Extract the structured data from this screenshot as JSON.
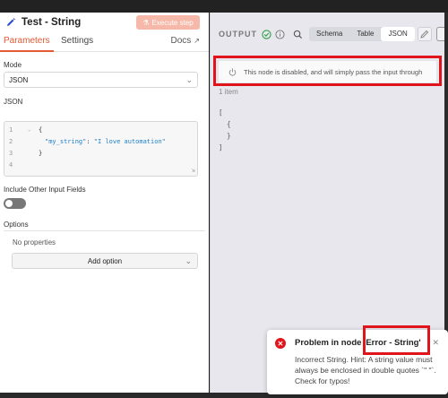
{
  "node": {
    "title": "Test - String",
    "execute_label": "Execute step"
  },
  "tabs": {
    "parameters": "Parameters",
    "settings": "Settings",
    "docs": "Docs"
  },
  "mode": {
    "label": "Mode",
    "value": "JSON"
  },
  "json_field": {
    "label": "JSON",
    "lines": [
      {
        "n": "1",
        "text": "{"
      },
      {
        "n": "2",
        "key": "\"my_string\"",
        "sep": ": ",
        "val": "\"I love automation\""
      },
      {
        "n": "3",
        "text": "}"
      },
      {
        "n": "4",
        "text": ""
      }
    ]
  },
  "include_label": "Include Other Input Fields",
  "include_toggle": false,
  "options": {
    "label": "Options",
    "empty_text": "No properties",
    "add_label": "Add option"
  },
  "output": {
    "title": "OUTPUT",
    "views": [
      "Schema",
      "Table",
      "JSON"
    ],
    "active_view": "JSON",
    "disabled_message": "This node is disabled, and will simply pass the input through",
    "items_count": "1 item",
    "json_text": "[\n  {\n  }\n]"
  },
  "toast": {
    "title": "Problem in node 'Error - String'",
    "body": "Incorrect String. Hint: A string value must always be enclosed in double quotes `\" \"`. Check for typos!"
  },
  "colors": {
    "accent": "#e45a35",
    "highlight": "#e0141b",
    "success": "#2f9e44"
  }
}
